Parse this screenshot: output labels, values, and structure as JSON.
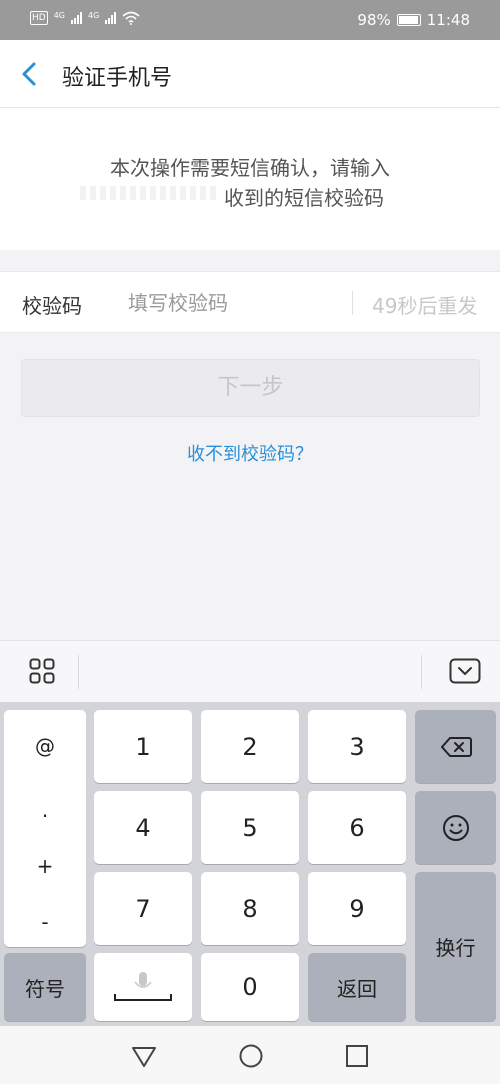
{
  "status_bar": {
    "hd_label": "HD",
    "net1": "4G",
    "net2": "4G",
    "battery_percent": "98%",
    "time": "11:48"
  },
  "header": {
    "title": "验证手机号"
  },
  "info": {
    "line1": "本次操作需要短信确认，请输入",
    "line2": "收到的短信校验码"
  },
  "code_field": {
    "label": "校验码",
    "placeholder": "填写校验码",
    "value": "",
    "resend_label": "49秒后重发"
  },
  "next_button": {
    "label": "下一步"
  },
  "help_link": {
    "label": "收不到校验码？"
  },
  "keyboard": {
    "symbols": [
      "@",
      ".",
      "+",
      "-"
    ],
    "digits": [
      "1",
      "2",
      "3",
      "4",
      "5",
      "6",
      "7",
      "8",
      "9",
      "0"
    ],
    "symbol_key": "符号",
    "return_key": "返回",
    "enter_key": "换行",
    "icons": {
      "grid": "grid-icon",
      "collapse": "keyboard-collapse-icon",
      "backspace": "backspace-icon",
      "emoji": "emoji-icon",
      "mic": "microphone-icon"
    }
  },
  "colors": {
    "accent": "#2a8fd9",
    "status_bar": "#9a9a9a",
    "keyboard_bg": "#d2d4da",
    "dark_key": "#abb0bb"
  }
}
